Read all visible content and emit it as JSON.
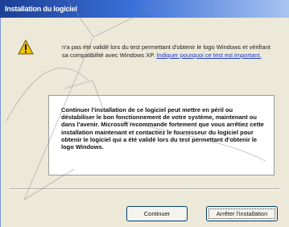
{
  "dialog": {
    "title": "Installation du logiciel",
    "message": "n'a pas été validé lors du test permettant d'obtenir le logo Windows et vérifiant sa compatibilité avec Windows XP.",
    "message_link": "Indiquer pourquoi ce test est important.",
    "warning": "Continuer l'installation de ce logiciel peut mettre en péril ou déstabiliser le bon fonctionnement de votre système, maintenant ou dans l'avenir. Microsoft recommande fortement que vous arrêtiez cette installation maintenant et contactiez le fournisseur du logiciel pour obtenir le logiciel qui a été validé lors du test permettant d'obtenir le logo Windows.",
    "continue_label": "Continuer",
    "stop_label": "Arrêter l'installation"
  },
  "icons": {
    "warning": "warning-triangle-icon"
  },
  "colors": {
    "titlebar": "#1c3f95",
    "dialog_bg": "#ece9d8",
    "link": "#1d3bc4",
    "warning_icon": "#f2c200"
  }
}
